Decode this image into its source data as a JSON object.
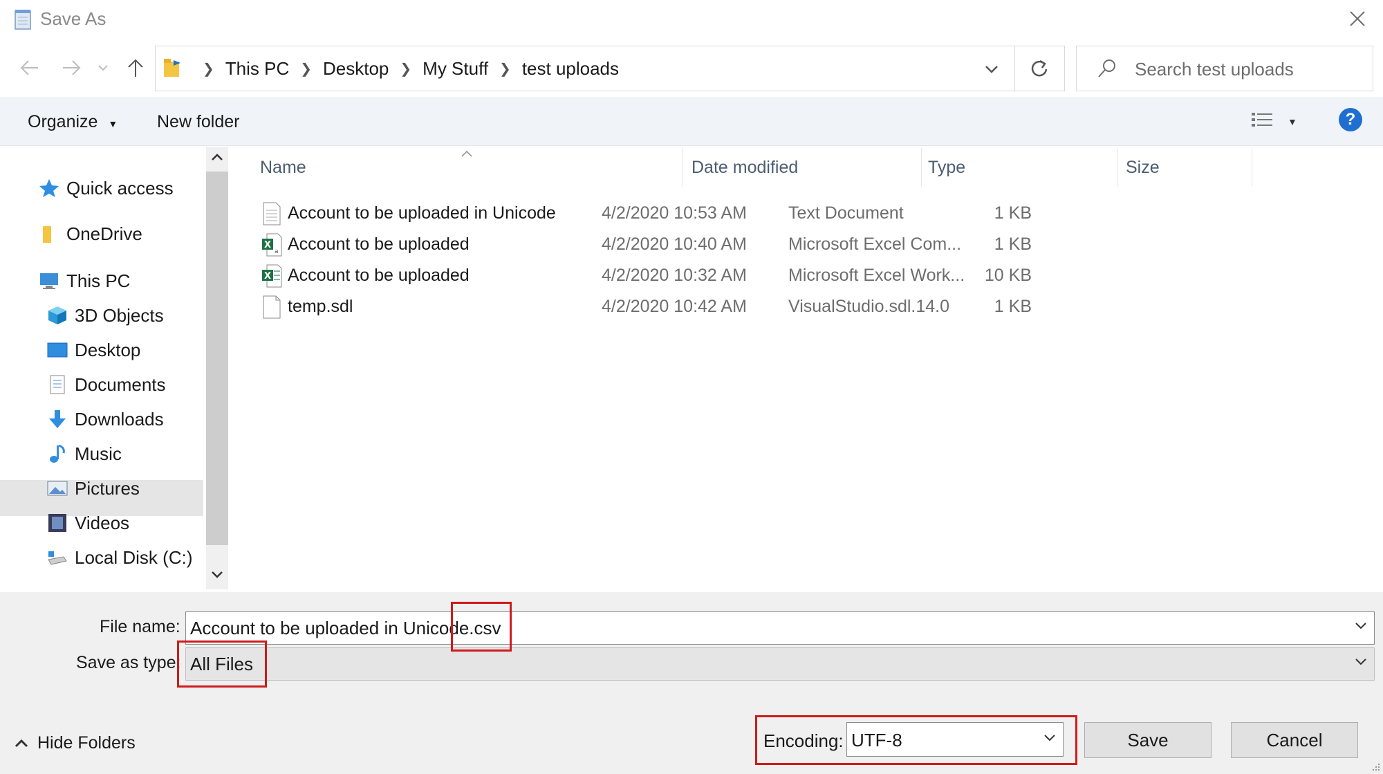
{
  "window": {
    "title": "Save As"
  },
  "nav": {
    "breadcrumbs": [
      "This PC",
      "Desktop",
      "My Stuff",
      "test uploads"
    ],
    "search_placeholder": "Search test uploads"
  },
  "toolbar": {
    "organize": "Organize",
    "new_folder": "New folder",
    "help": "?"
  },
  "sidebar": {
    "items": [
      {
        "label": "Quick access",
        "icon": "star-icon"
      },
      {
        "label": "OneDrive",
        "icon": "folder-icon"
      },
      {
        "label": "This PC",
        "icon": "computer-icon"
      },
      {
        "label": "3D Objects",
        "icon": "cube-icon"
      },
      {
        "label": "Desktop",
        "icon": "desktop-icon",
        "selected": true
      },
      {
        "label": "Documents",
        "icon": "documents-icon"
      },
      {
        "label": "Downloads",
        "icon": "download-icon"
      },
      {
        "label": "Music",
        "icon": "music-icon"
      },
      {
        "label": "Pictures",
        "icon": "pictures-icon"
      },
      {
        "label": "Videos",
        "icon": "videos-icon"
      },
      {
        "label": "Local Disk (C:)",
        "icon": "disk-icon"
      }
    ]
  },
  "files": {
    "columns": [
      "Name",
      "Date modified",
      "Type",
      "Size"
    ],
    "rows": [
      {
        "name": "Account to be uploaded in Unicode",
        "date": "4/2/2020 10:53 AM",
        "type": "Text Document",
        "size": "1 KB",
        "icon": "text-file-icon"
      },
      {
        "name": "Account to be uploaded",
        "date": "4/2/2020 10:40 AM",
        "type": "Microsoft Excel Com...",
        "size": "1 KB",
        "icon": "excel-csv-icon"
      },
      {
        "name": "Account to be uploaded",
        "date": "4/2/2020 10:32 AM",
        "type": "Microsoft Excel Work...",
        "size": "10 KB",
        "icon": "excel-workbook-icon"
      },
      {
        "name": "temp.sdl",
        "date": "4/2/2020 10:42 AM",
        "type": "VisualStudio.sdl.14.0",
        "size": "1 KB",
        "icon": "blank-file-icon"
      }
    ]
  },
  "form": {
    "file_name_label": "File name:",
    "file_name_value": "Account to be uploaded in Unicode.csv",
    "save_type_label": "Save as type:",
    "save_type_value": "All Files",
    "hide_folders": "Hide Folders",
    "encoding_label": "Encoding:",
    "encoding_value": "UTF-8",
    "save": "Save",
    "cancel": "Cancel"
  },
  "colors": {
    "highlight_box": "#d01a1a",
    "accent": "#1f6fd0",
    "selected_bg": "#e5e5e5"
  }
}
